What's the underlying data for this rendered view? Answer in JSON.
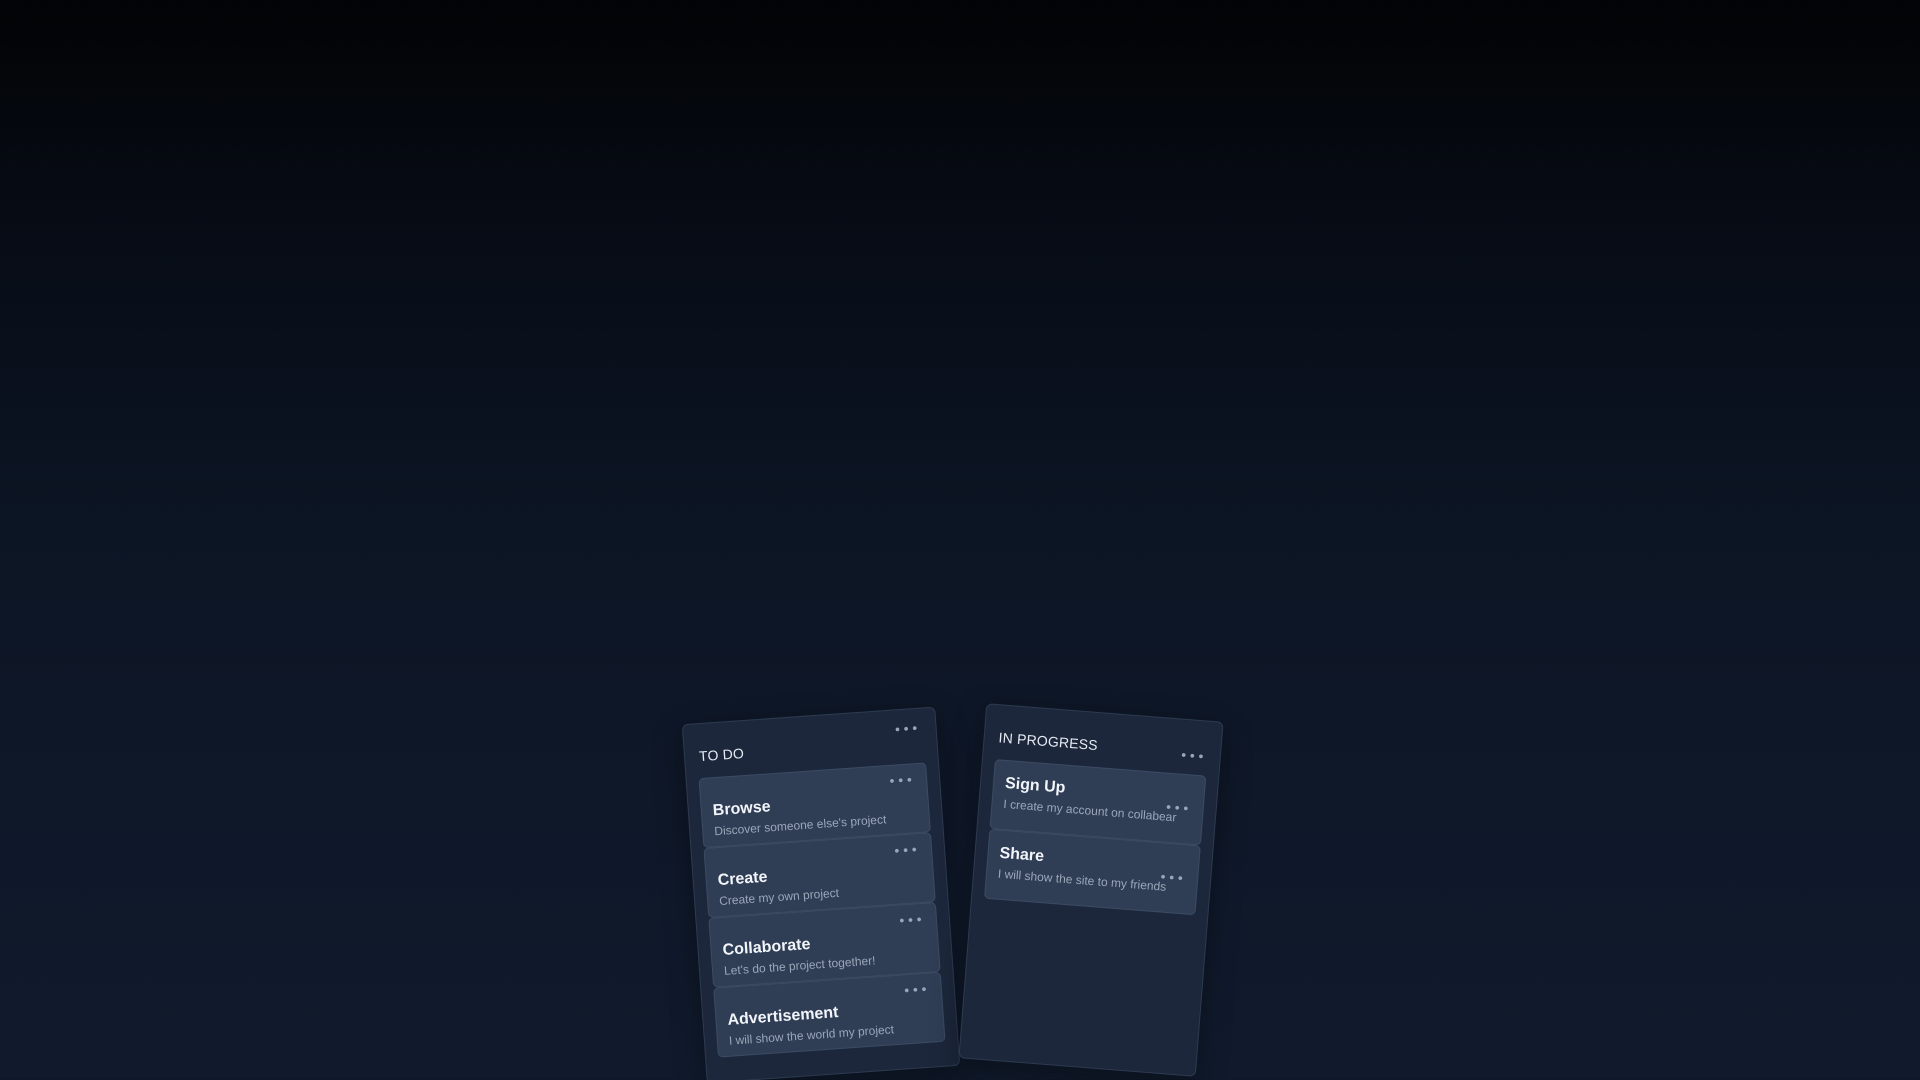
{
  "board": {
    "columns": [
      {
        "title": "TO DO",
        "menu_icon": "ellipsis-icon",
        "cards": [
          {
            "title": "Browse",
            "description": "Discover someone else's project"
          },
          {
            "title": "Create",
            "description": "Create my own project"
          },
          {
            "title": "Collaborate",
            "description": "Let's do the project together!"
          },
          {
            "title": "Advertisement",
            "description": "I will show the world my project"
          }
        ]
      },
      {
        "title": "IN PROGRESS",
        "menu_icon": "ellipsis-icon",
        "cards": [
          {
            "title": "Sign Up",
            "description": "I create my account on collabear"
          },
          {
            "title": "Share",
            "description": "I will show the site to my friends"
          }
        ]
      }
    ],
    "menu_glyph": "•••"
  },
  "colors": {
    "background_top": "#020305",
    "background_bottom": "#101a2c",
    "column": "#1c273b",
    "card": "#2f3d55",
    "title_text": "#f2f5fa",
    "muted_text": "#9ba7b9"
  }
}
